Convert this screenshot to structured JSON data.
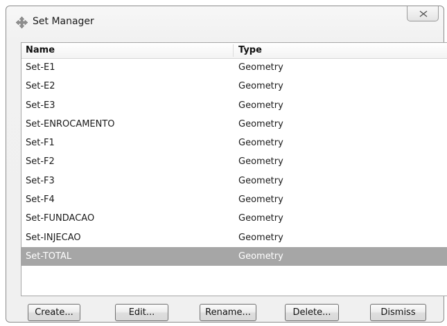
{
  "window": {
    "title": "Set Manager",
    "close_icon": "close-x-icon",
    "title_icon": "cross-arrows-icon"
  },
  "table": {
    "columns": [
      "Name",
      "Type"
    ],
    "rows": [
      {
        "name": "Set-E1",
        "type": "Geometry"
      },
      {
        "name": "Set-E2",
        "type": "Geometry"
      },
      {
        "name": "Set-E3",
        "type": "Geometry"
      },
      {
        "name": "Set-ENROCAMENTO",
        "type": "Geometry"
      },
      {
        "name": "Set-F1",
        "type": "Geometry"
      },
      {
        "name": "Set-F2",
        "type": "Geometry"
      },
      {
        "name": "Set-F3",
        "type": "Geometry"
      },
      {
        "name": "Set-F4",
        "type": "Geometry"
      },
      {
        "name": "Set-FUNDACAO",
        "type": "Geometry"
      },
      {
        "name": "Set-INJECAO",
        "type": "Geometry"
      },
      {
        "name": "Set-TOTAL",
        "type": "Geometry"
      }
    ],
    "selected_row": "Set-TOTAL",
    "selection_color": "#a6a6a6"
  },
  "buttons": {
    "create": "Create...",
    "edit": "Edit...",
    "rename": "Rename...",
    "delete": "Delete...",
    "dismiss": "Dismiss"
  }
}
